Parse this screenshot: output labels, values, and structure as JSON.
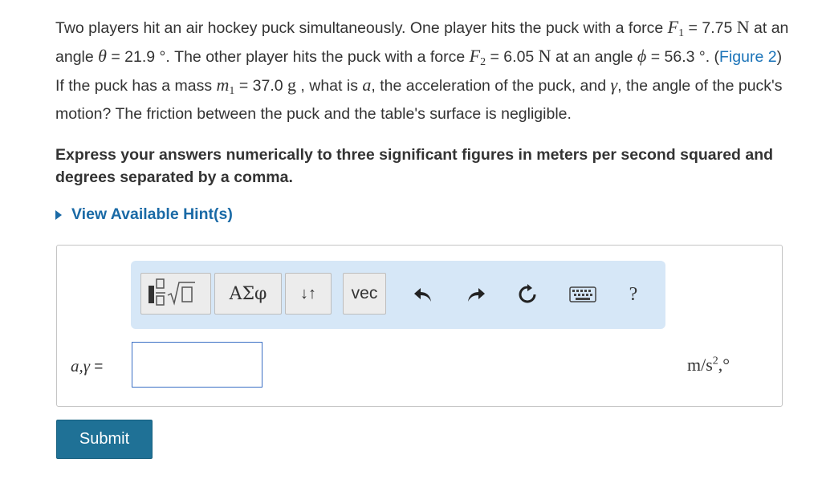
{
  "problem": {
    "p1": "Two players hit an air hockey puck simultaneously. One player hits the puck with a force ",
    "F1_sym": "F",
    "F1_sub": "1",
    "p2": " = 7.75 ",
    "unit_N": "N",
    "p3": " at an angle ",
    "theta_sym": "θ",
    "p4": " = 21.9 °. The other player hits the puck with a force ",
    "F2_sym": "F",
    "F2_sub": "2",
    "p5": " = 6.05 ",
    "p6": " at an angle ",
    "phi_sym": "ϕ",
    "p7": " = 56.3 °. (",
    "figure_link": "Figure 2",
    "p8": ") If the puck has a mass ",
    "m_sym": "m",
    "m_sub": "1",
    "p9": " = 37.0 ",
    "unit_g": "g",
    "p10": " , what is ",
    "a_sym": "a",
    "p11": ", the acceleration of the puck, and ",
    "gamma_sym": "γ",
    "p12": ", the angle of the puck's motion? The friction between the puck and the table's surface is negligible."
  },
  "instructions": "Express your answers numerically to three significant figures in meters per second squared and degrees separated by a comma.",
  "hint_label": "View Available Hint(s)",
  "toolbar": {
    "greek_label": "ΑΣφ",
    "arrows_label": "↓↑",
    "vec_label": "vec",
    "help_label": "?"
  },
  "answer": {
    "label_vars": "a,γ",
    "label_eq": " =",
    "value": "",
    "units_main": "m/s",
    "units_exp": "2",
    "units_tail": ",°"
  },
  "submit_label": "Submit",
  "colors": {
    "link": "#1a73b8",
    "hint": "#1a6aa6",
    "toolbar_bg": "#d6e7f7",
    "submit_bg": "#1f7196",
    "input_border": "#3a6fc4"
  }
}
